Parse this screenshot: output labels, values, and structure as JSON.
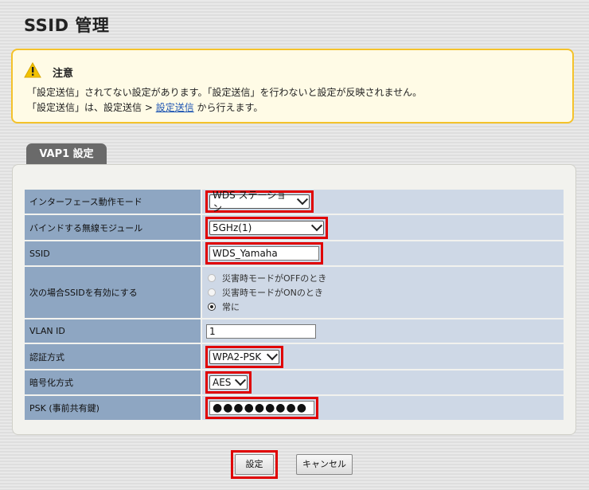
{
  "page": {
    "title": "SSID 管理"
  },
  "notice": {
    "title": "注意",
    "line1": "「設定送信」されてない設定があります。「設定送信」を行わないと設定が反映されません。",
    "line2_prefix": "「設定送信」は、設定送信 > ",
    "line2_link": "設定送信",
    "line2_suffix": " から行えます。"
  },
  "tab": {
    "label": "VAP1 設定"
  },
  "settings": {
    "mode": {
      "label": "インターフェース動作モード",
      "value": "WDS ステーション"
    },
    "module": {
      "label": "バインドする無線モジュール",
      "value": "5GHz(1)"
    },
    "ssid": {
      "label": "SSID",
      "value": "WDS_Yamaha"
    },
    "enable": {
      "label": "次の場合SSIDを有効にする",
      "options": [
        "災害時モードがOFFのとき",
        "災害時モードがONのとき",
        "常に"
      ],
      "selected": "常に"
    },
    "vlan": {
      "label": "VLAN ID",
      "value": "1"
    },
    "auth": {
      "label": "認証方式",
      "value": "WPA2-PSK"
    },
    "enc": {
      "label": "暗号化方式",
      "value": "AES"
    },
    "psk": {
      "label": "PSK (事前共有鍵)",
      "value": "●●●●●●●●●"
    }
  },
  "buttons": {
    "submit": "設定",
    "cancel": "キャンセル"
  },
  "colors": {
    "highlight": "#e00000",
    "label_bg": "#8ea6c2",
    "value_bg": "#ced8e6",
    "notice_border": "#f4c22b",
    "link": "#1f56b3"
  }
}
